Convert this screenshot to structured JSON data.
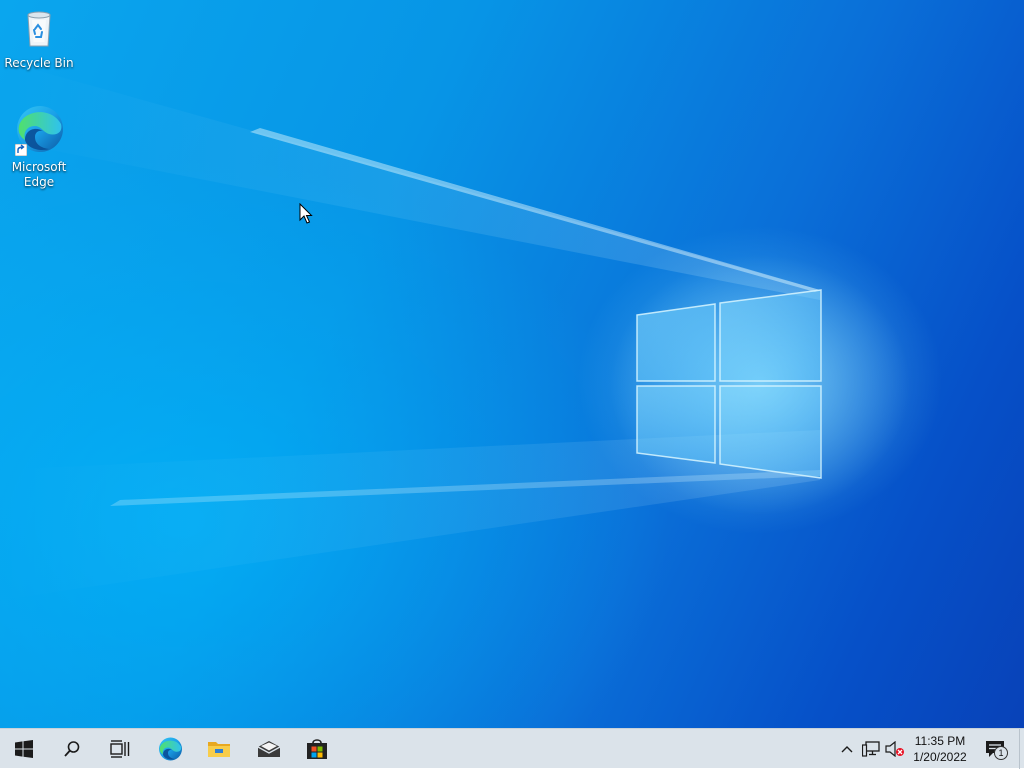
{
  "desktop": {
    "icons": [
      {
        "id": "recycle-bin",
        "label": "Recycle Bin",
        "icon": "recycle-bin-icon"
      },
      {
        "id": "microsoft-edge",
        "label": "Microsoft Edge",
        "icon": "edge-icon"
      }
    ]
  },
  "taskbar": {
    "pinned": [
      {
        "id": "start",
        "icon": "windows-logo-icon"
      },
      {
        "id": "search",
        "icon": "search-icon"
      },
      {
        "id": "task-view",
        "icon": "task-view-icon"
      },
      {
        "id": "edge",
        "icon": "edge-icon"
      },
      {
        "id": "file-explorer",
        "icon": "folder-icon"
      },
      {
        "id": "mail",
        "icon": "mail-icon"
      },
      {
        "id": "store",
        "icon": "store-icon"
      }
    ],
    "tray": {
      "icons": [
        "chevron-up-icon",
        "network-icon",
        "volume-muted-icon"
      ],
      "time": "11:35 PM",
      "date": "1/20/2022",
      "notification_count": "1"
    }
  },
  "colors": {
    "accent": "#0078d7",
    "taskbar_bg": "#dbe3ea",
    "wallpaper_dark": "#0842b8",
    "wallpaper_light": "#0aa6ee"
  }
}
